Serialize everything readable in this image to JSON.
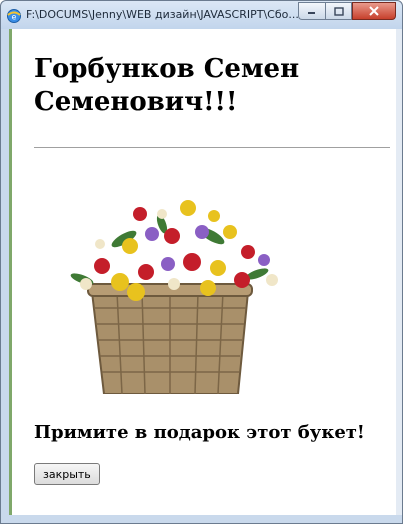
{
  "window": {
    "title": "F:\\DOCUMS\\Jenny\\WEB дизайн\\JAVASCRIPT\\Сбо..."
  },
  "page": {
    "heading": "Горбунков Семен Семенович!!!",
    "message": "Примите в подарок этот букет!",
    "close_button_label": "закрыть"
  },
  "icons": [
    "browser-icon",
    "minimize-icon",
    "maximize-icon",
    "close-icon",
    "flower-basket-image"
  ]
}
